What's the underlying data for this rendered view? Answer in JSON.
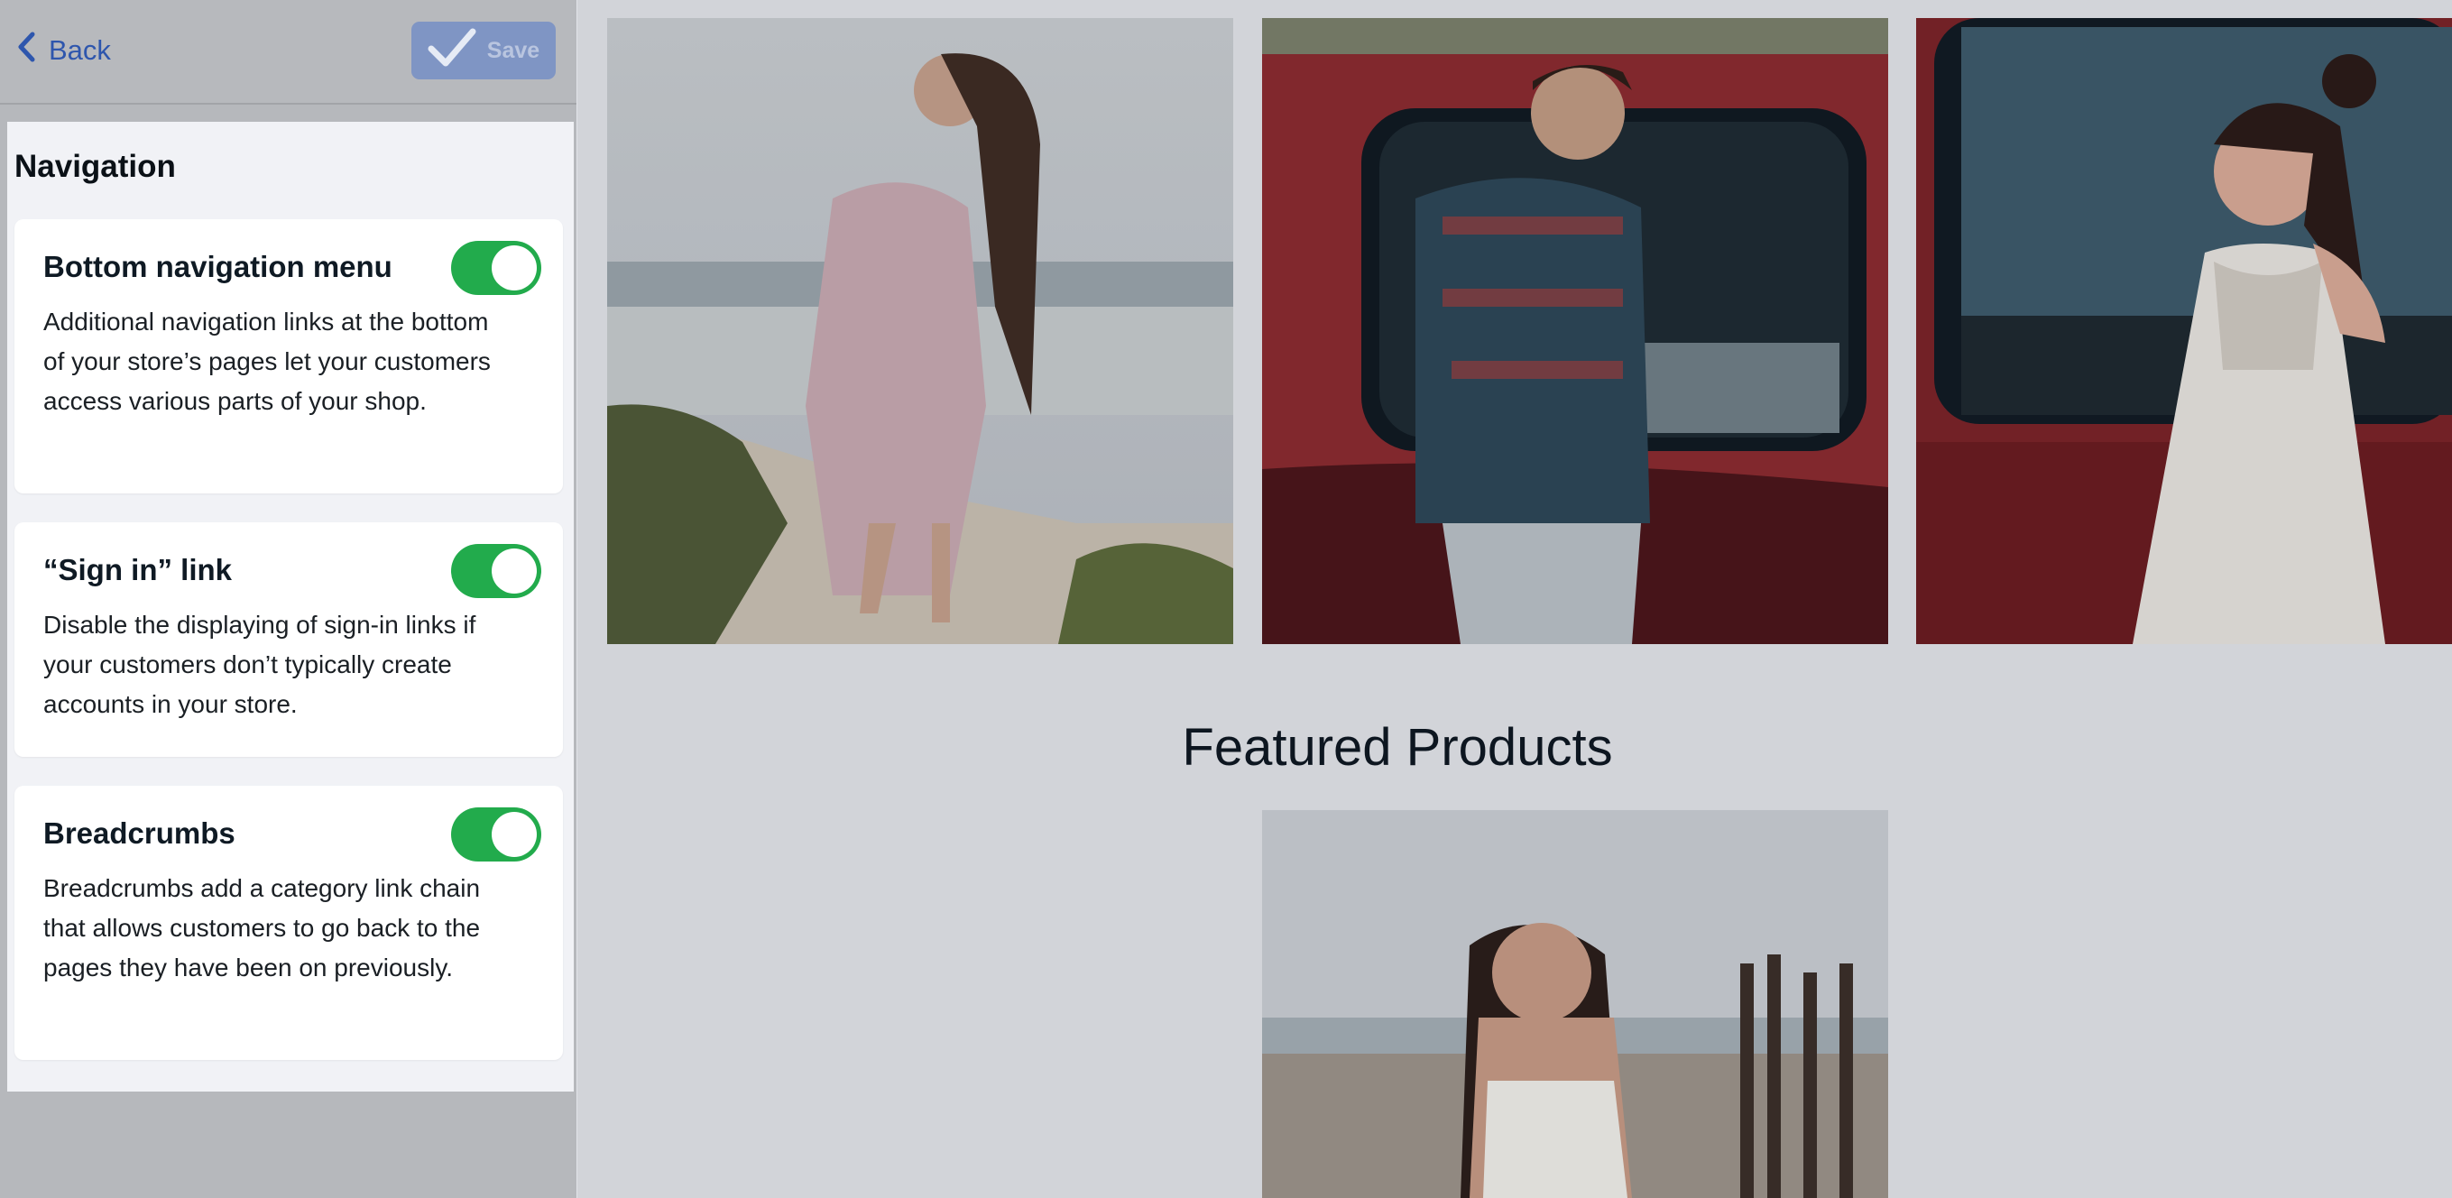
{
  "topbar": {
    "back_label": "Back",
    "save_label": "Save"
  },
  "navigation": {
    "title": "Navigation",
    "settings": [
      {
        "title": "Bottom navigation menu",
        "description": "Additional navigation links at the bottom of your store’s pages let your customers access various parts of your shop.",
        "enabled": true
      },
      {
        "title": "“Sign in” link",
        "description": "Disable the displaying of sign-in links if your customers don’t typically create accounts in your store.",
        "enabled": true
      },
      {
        "title": "Breadcrumbs",
        "description": "Breadcrumbs add a category link chain that allows customers to go back to the pages they have been on previously.",
        "enabled": true
      }
    ]
  },
  "preview": {
    "featured_title": "Featured Products"
  },
  "colors": {
    "accent_blue": "#2e56ad",
    "toggle_on": "#22ab4c",
    "panel_bg": "#f1f2f6"
  }
}
